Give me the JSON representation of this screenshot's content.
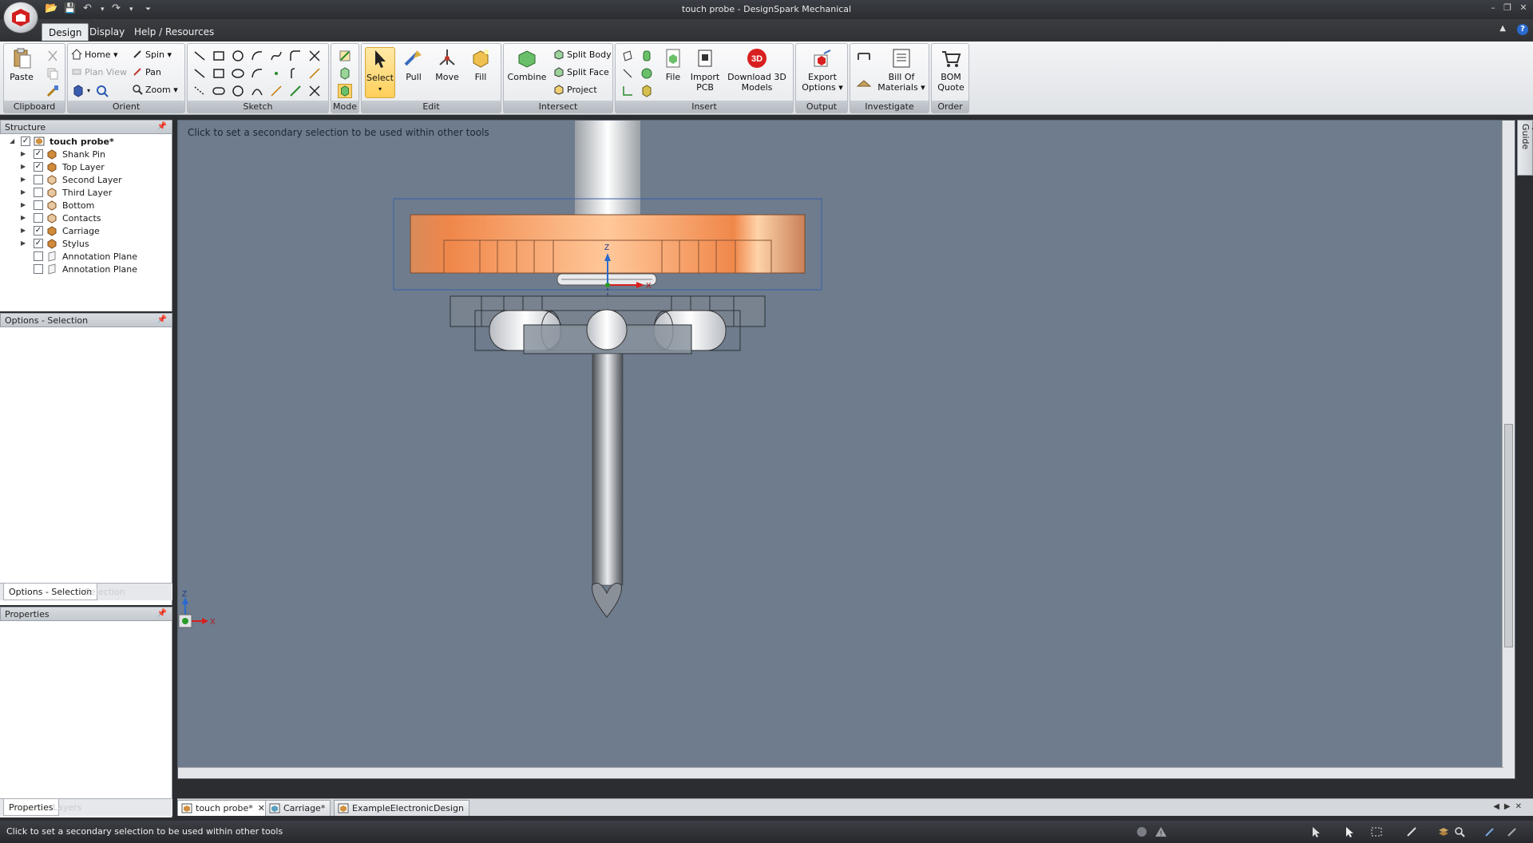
{
  "app": {
    "title": "touch probe - DesignSpark Mechanical"
  },
  "ribbon_tabs": [
    {
      "label": "Design",
      "active": true
    },
    {
      "label": "Display",
      "active": false
    },
    {
      "label": "Help / Resources",
      "active": false
    }
  ],
  "ribbon": {
    "clipboard": {
      "label": "Clipboard",
      "paste": "Paste"
    },
    "orient": {
      "label": "Orient",
      "home": "Home",
      "plan_view": "Plan View",
      "spin": "Spin",
      "pan": "Pan",
      "zoom": "Zoom"
    },
    "sketch": {
      "label": "Sketch"
    },
    "mode": {
      "label": "Mode"
    },
    "edit": {
      "label": "Edit",
      "select": "Select",
      "pull": "Pull",
      "move": "Move",
      "fill": "Fill"
    },
    "intersect": {
      "label": "Intersect",
      "combine": "Combine",
      "split_body": "Split Body",
      "split_face": "Split Face",
      "project": "Project"
    },
    "insert": {
      "label": "Insert",
      "file": "File",
      "import_pcb_1": "Import",
      "import_pcb_2": "PCB",
      "download_1": "Download 3D",
      "download_2": "Models"
    },
    "output": {
      "label": "Output",
      "export_1": "Export",
      "export_2": "Options"
    },
    "investigate": {
      "label": "Investigate",
      "bom_1": "Bill Of",
      "bom_2": "Materials"
    },
    "order": {
      "label": "Order",
      "quote_1": "BOM",
      "quote_2": "Quote"
    }
  },
  "structure": {
    "header": "Structure",
    "root": "touch probe*",
    "items": [
      {
        "label": "Shank Pin",
        "checked": true,
        "expandable": true
      },
      {
        "label": "Top Layer",
        "checked": true,
        "expandable": true
      },
      {
        "label": "Second Layer",
        "checked": false,
        "expandable": true
      },
      {
        "label": "Third Layer",
        "checked": false,
        "expandable": true
      },
      {
        "label": "Bottom",
        "checked": false,
        "expandable": true
      },
      {
        "label": "Contacts",
        "checked": false,
        "expandable": true
      },
      {
        "label": "Carriage",
        "checked": true,
        "expandable": true
      },
      {
        "label": "Stylus",
        "checked": true,
        "expandable": true
      },
      {
        "label": "Annotation Plane",
        "checked": false,
        "expandable": false
      },
      {
        "label": "Annotation Plane",
        "checked": false,
        "expandable": false
      }
    ]
  },
  "options_panel": {
    "header": "Options - Selection",
    "tab": "Options - Selection",
    "ghost_tab": "Selection"
  },
  "properties_panel": {
    "header": "Properties",
    "tab": "Properties",
    "ghost_tab": "Layers"
  },
  "viewport": {
    "hint": "Click to set a secondary selection to be used within other tools",
    "axis_z": "Z",
    "axis_x": "X"
  },
  "quick_guide": "Quick Guide",
  "doc_tabs": [
    {
      "label": "touch probe*",
      "active": true,
      "closable": true
    },
    {
      "label": "Carriage*",
      "active": false,
      "closable": false
    },
    {
      "label": "ExampleElectronicDesign",
      "active": false,
      "closable": false
    }
  ],
  "status": {
    "text": "Click to set a secondary selection to be used within other tools"
  },
  "colors": {
    "viewport_bg": "#6e7c8d",
    "top_layer": "#f08a4b",
    "accent": "#ffcf5a"
  }
}
